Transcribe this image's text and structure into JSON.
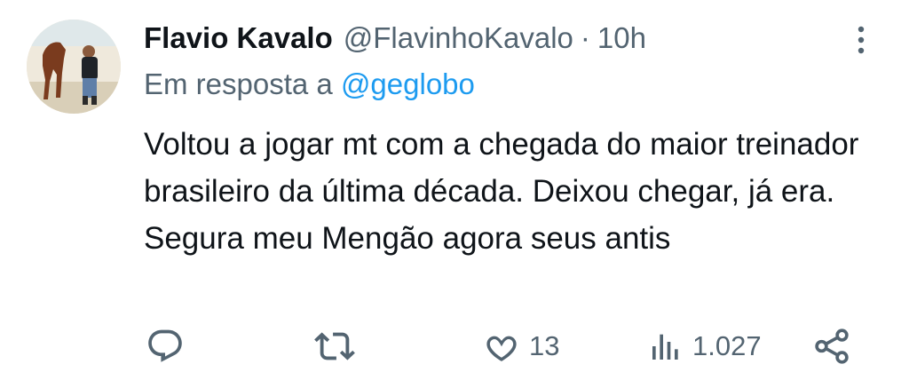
{
  "tweet": {
    "author_name": "Flavio Kavalo",
    "author_handle": "@FlavinhoKavalo",
    "separator": "·",
    "time": "10h",
    "reply_prefix": "Em resposta a",
    "reply_to": "@geglobo",
    "text": "Voltou a jogar mt com a chegada do maior treinador brasileiro da última década. Deixou chegar, já era. Segura meu Mengão agora seus antis"
  },
  "actions": {
    "likes": "13",
    "views": "1.027"
  },
  "icons": [
    "avatar",
    "more-icon",
    "reply-icon",
    "retweet-icon",
    "like-icon",
    "views-icon",
    "share-icon"
  ],
  "colors": {
    "text": "#0f1419",
    "secondary": "#536471",
    "link": "#1d9bf0"
  }
}
